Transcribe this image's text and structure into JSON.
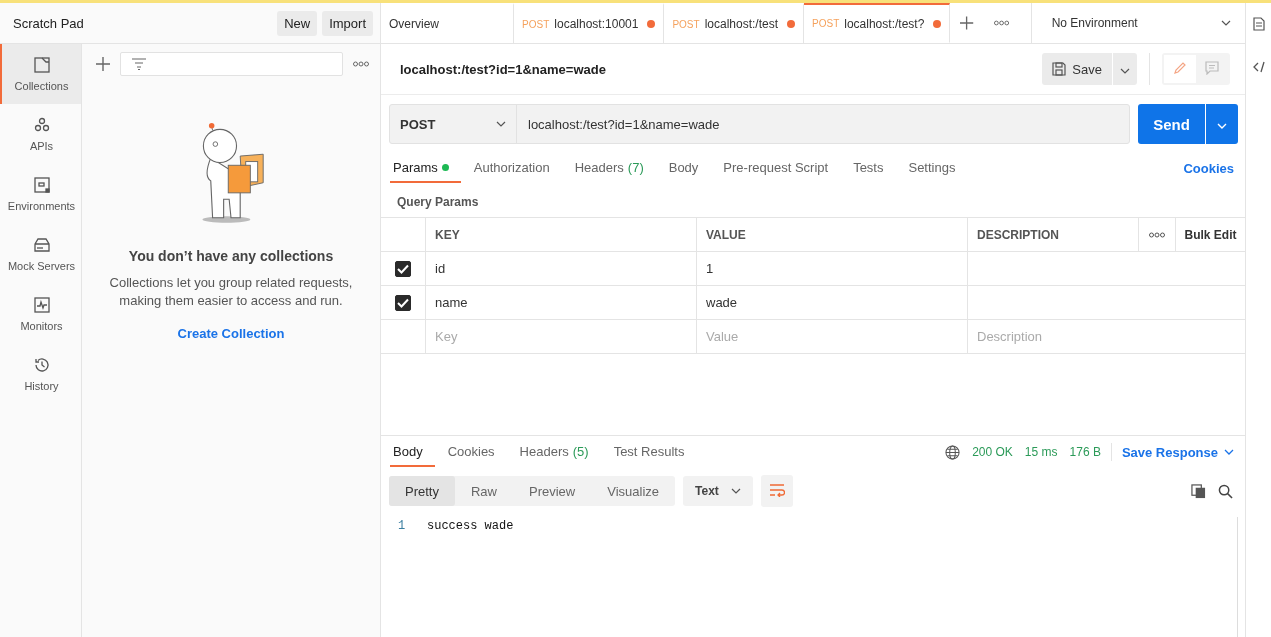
{
  "sidebar": {
    "title": "Scratch Pad",
    "buttons": [
      "New",
      "Import"
    ],
    "nav": [
      {
        "kind": "collections",
        "label": "Collections",
        "selected": true
      },
      {
        "kind": "apis",
        "label": "APIs",
        "selected": false
      },
      {
        "kind": "environments",
        "label": "Environments",
        "selected": false
      },
      {
        "kind": "mock",
        "label": "Mock Servers",
        "selected": false
      },
      {
        "kind": "monitors",
        "label": "Monitors",
        "selected": false
      },
      {
        "kind": "history",
        "label": "History",
        "selected": false
      }
    ],
    "empty_state": {
      "title": "You don’t have any collections",
      "text": "Collections let you group related requests, making them easier to access and run.",
      "link": "Create Collection"
    }
  },
  "tabs": [
    {
      "label": "Overview",
      "unsaved": false,
      "selected": false
    },
    {
      "method": "POST",
      "label": "localhost:10001",
      "unsaved": true,
      "selected": false
    },
    {
      "method": "POST",
      "label": "localhost:/test",
      "unsaved": true,
      "selected": false
    },
    {
      "method": "POST",
      "label": "localhost:/test?",
      "unsaved": true,
      "selected": true
    }
  ],
  "environment": "No Environment",
  "request": {
    "name": "localhost:/test?id=1&name=wade",
    "save": "Save",
    "method": "POST",
    "url": "localhost:/test?id=1&name=wade",
    "send": "Send"
  },
  "request_tabs": [
    {
      "label": "Params",
      "dot": true,
      "selected": true
    },
    {
      "label": "Authorization",
      "dot": false,
      "selected": false
    },
    {
      "label": "Headers",
      "count": "(7)",
      "dot": false,
      "selected": false
    },
    {
      "label": "Body",
      "dot": false,
      "selected": false
    },
    {
      "label": "Pre-request Script",
      "dot": false,
      "selected": false
    },
    {
      "label": "Tests",
      "dot": false,
      "selected": false
    },
    {
      "label": "Settings",
      "dot": false,
      "selected": false
    }
  ],
  "cookies": "Cookies",
  "query_params": {
    "title": "Query Params",
    "columns": [
      "KEY",
      "VALUE",
      "DESCRIPTION"
    ],
    "bulk_edit": "Bulk Edit",
    "rows": [
      {
        "checked": true,
        "key": "id",
        "value": "1"
      },
      {
        "checked": true,
        "key": "name",
        "value": "wade"
      }
    ],
    "new_row": {
      "key_placeholder": "Key",
      "value_placeholder": "Value",
      "description_placeholder": "Description"
    }
  },
  "response": {
    "tabs": [
      {
        "label": "Body",
        "selected": true
      },
      {
        "label": "Cookies",
        "selected": false
      },
      {
        "label": "Headers",
        "count": "(5)",
        "selected": false
      },
      {
        "label": "Test Results",
        "selected": false
      }
    ],
    "status": "200 OK",
    "time": "15 ms",
    "size": "176 B",
    "save_response": "Save Response",
    "view_modes": [
      {
        "label": "Pretty",
        "selected": true
      },
      {
        "label": "Raw",
        "selected": false
      },
      {
        "label": "Preview",
        "selected": false
      },
      {
        "label": "Visualize",
        "selected": false
      }
    ],
    "format": "Text",
    "lines": [
      {
        "number": "1",
        "text": "success wade"
      }
    ]
  }
}
